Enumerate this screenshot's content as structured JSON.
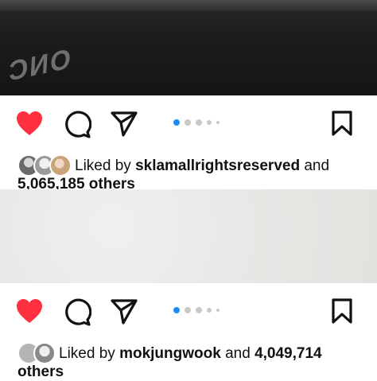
{
  "post1": {
    "liked_by_prefix": "Liked by",
    "liked_by_user": "sklamallrightsreserved",
    "and_word": "and",
    "others_count": "5,065,185 others",
    "carousel": {
      "total_dots": 5,
      "active_index": 0
    }
  },
  "post2": {
    "liked_by_prefix": "Liked by",
    "liked_by_user": "mokjungwook",
    "and_word": "and",
    "others_count_number": "4,049,714",
    "others_word": "others",
    "carousel": {
      "total_dots": 5,
      "active_index": 0
    }
  },
  "icons": {
    "like": "heart-icon",
    "comment": "comment-icon",
    "share": "share-icon",
    "save": "bookmark-icon"
  },
  "colors": {
    "like_red": "#ff3040",
    "carousel_active": "#1a8cff",
    "carousel_inactive": "#c9c9c9"
  }
}
